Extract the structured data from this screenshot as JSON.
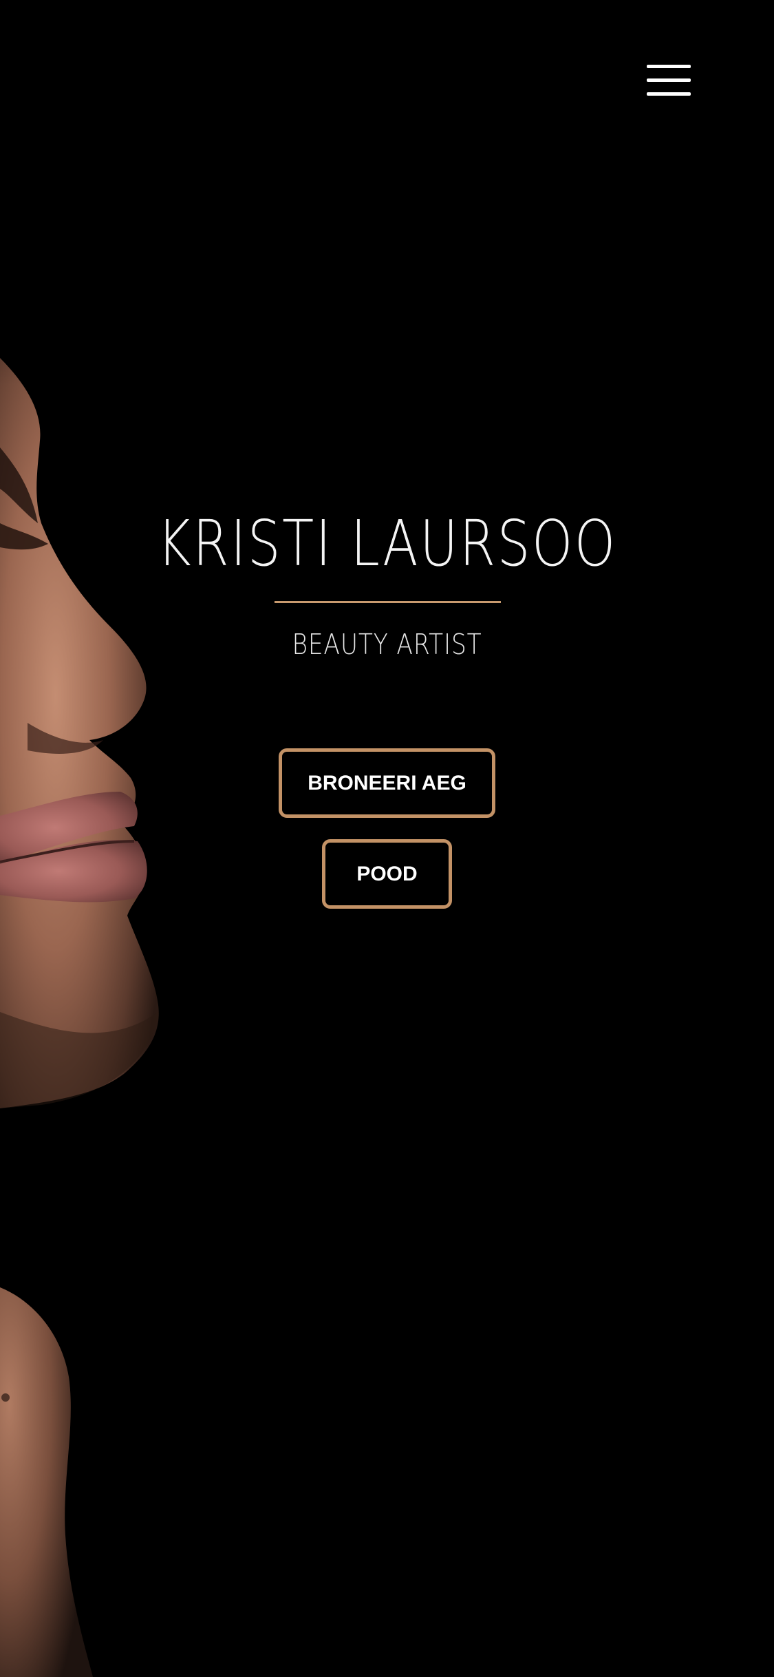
{
  "header": {
    "menu_icon": "hamburger-menu-icon"
  },
  "hero": {
    "title": "KRISTI LAURSOO",
    "subtitle": "BEAUTY ARTIST",
    "accent_color": "#c39266"
  },
  "actions": {
    "book_label": "BRONEERI AEG",
    "shop_label": "POOD"
  },
  "background": {
    "image": "woman-profile-portrait",
    "color": "#000000"
  }
}
